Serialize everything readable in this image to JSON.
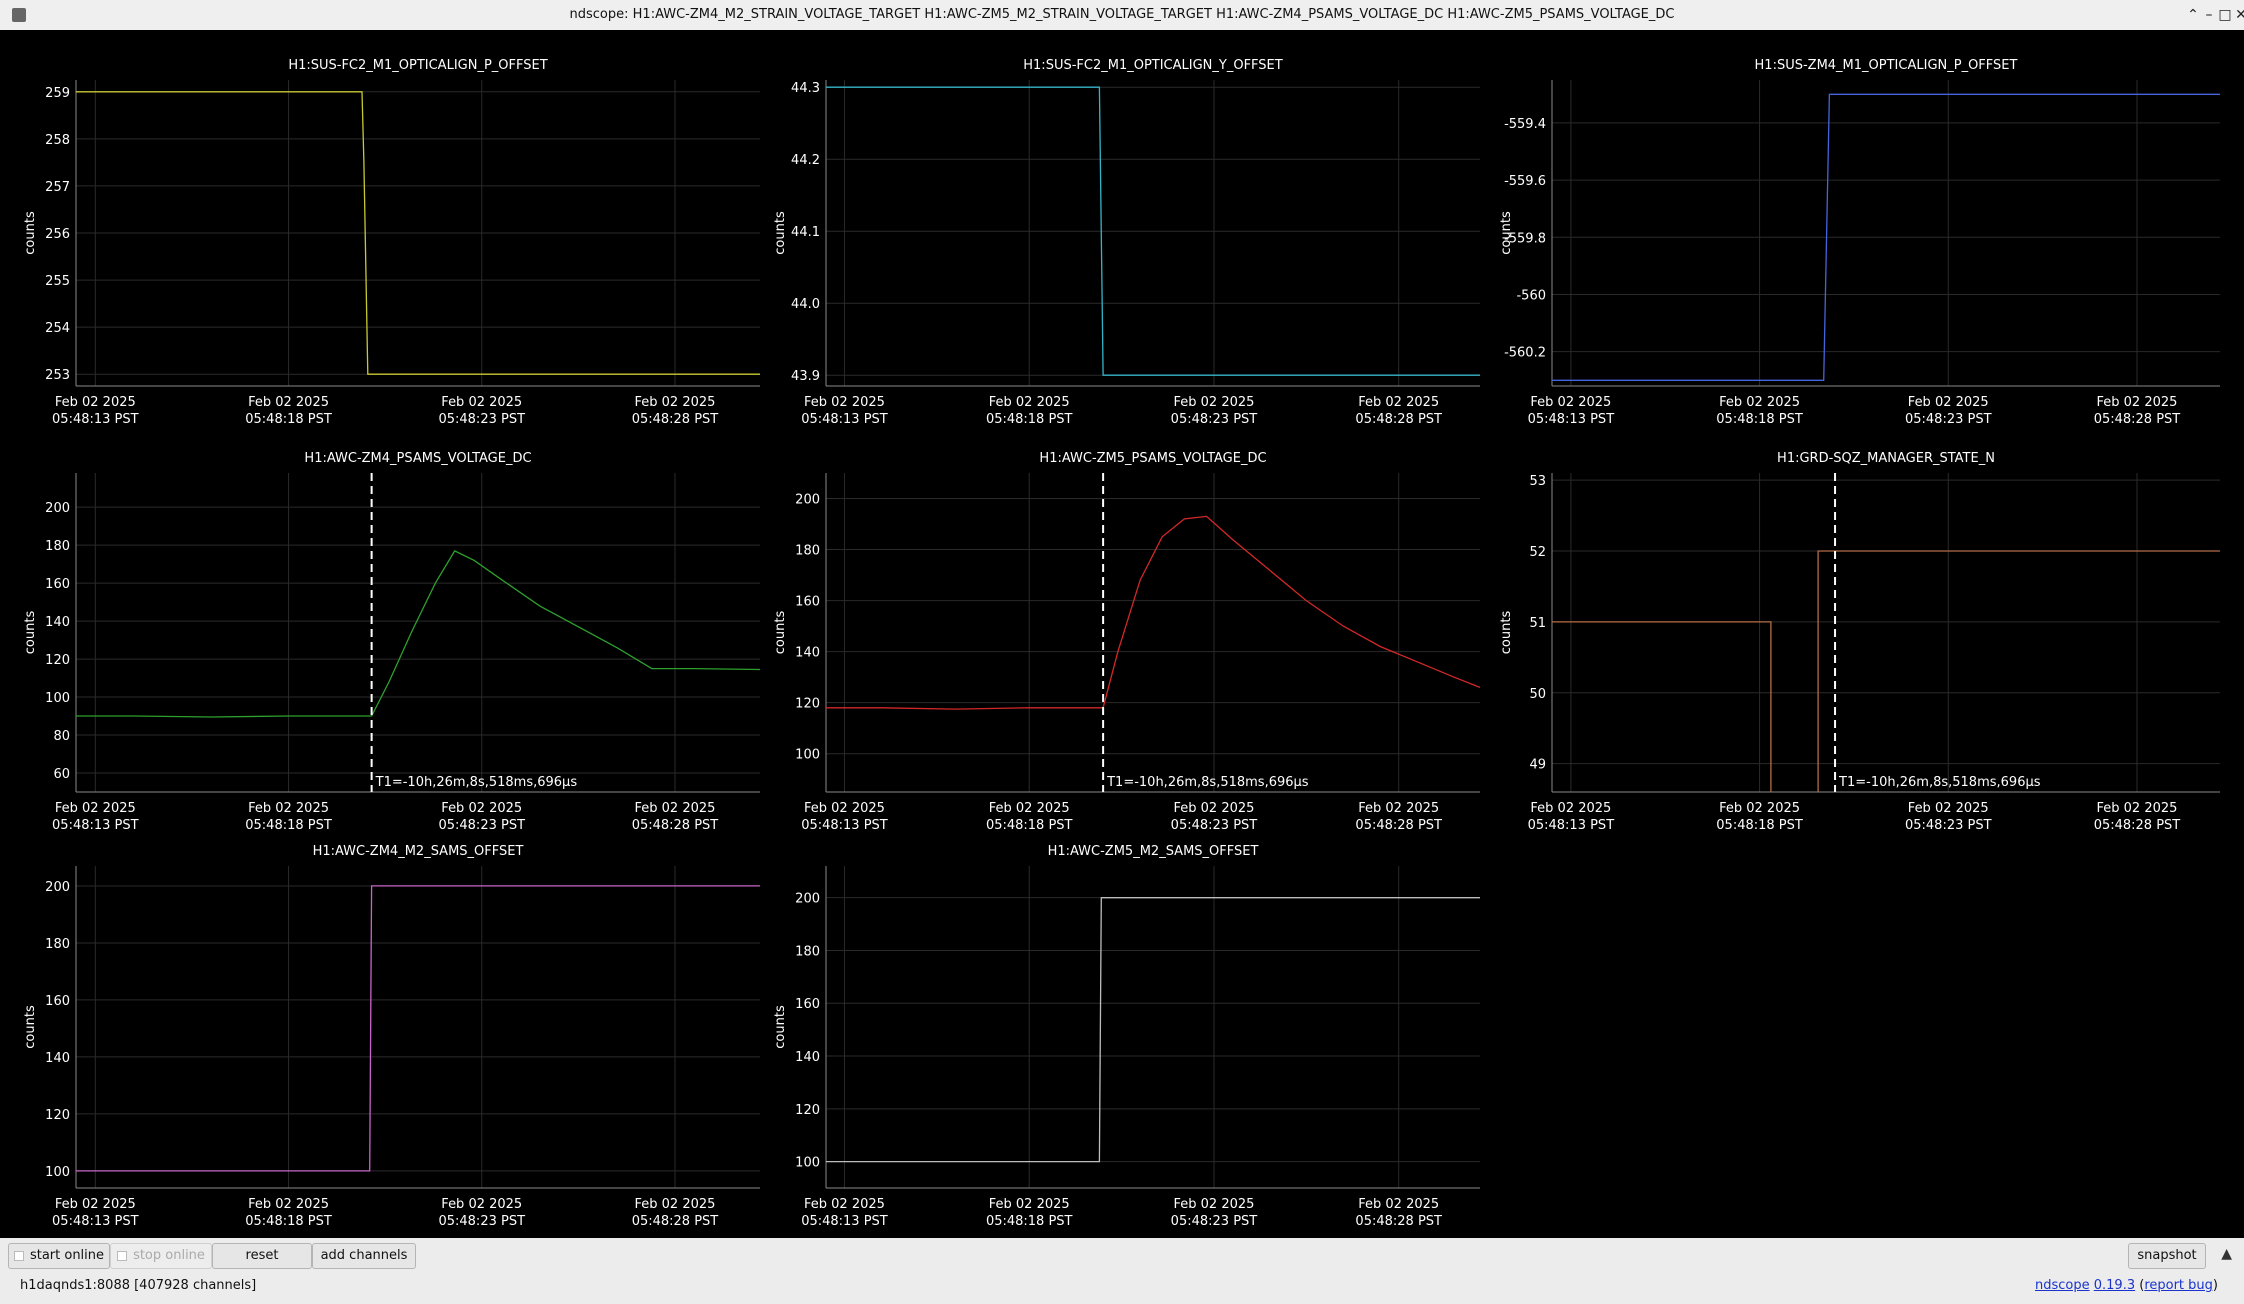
{
  "window": {
    "title": "ndscope: H1:AWC-ZM4_M2_STRAIN_VOLTAGE_TARGET H1:AWC-ZM5_M2_STRAIN_VOLTAGE_TARGET H1:AWC-ZM4_PSAMS_VOLTAGE_DC H1:AWC-ZM5_PSAMS_VOLTAGE_DC",
    "minimize_glyph": "–",
    "maximize_glyph": "□",
    "restore_glyph": "⌃",
    "close_glyph": "✕"
  },
  "toolbar": {
    "start_online": "start online",
    "stop_online": "stop online",
    "reset": "reset",
    "add_channels": "add channels",
    "snapshot": "snapshot",
    "collapse_glyph": "▲"
  },
  "status": {
    "server": "h1daqnds1:8088  [407928 channels]",
    "app_name": "ndscope",
    "version": "0.19.3",
    "report_bug": "report bug"
  },
  "common": {
    "ylabel": "counts",
    "x_ticks": [
      {
        "date": "Feb 02 2025",
        "time": "05:48:13 PST"
      },
      {
        "date": "Feb 02 2025",
        "time": "05:48:18 PST"
      },
      {
        "date": "Feb 02 2025",
        "time": "05:48:23 PST"
      },
      {
        "date": "Feb 02 2025",
        "time": "05:48:28 PST"
      }
    ],
    "cursor_label": "T1=-10h,26m,8s,518ms,696μs"
  },
  "chart_data": [
    {
      "type": "line",
      "title": "H1:SUS-FC2_M1_OPTICALIGN_P_OFFSET",
      "ylabel": "counts",
      "color": "#c8c832",
      "x_range": [
        12.5,
        30.2
      ],
      "ylim": [
        252.75,
        259.25
      ],
      "y_ticks": [
        253,
        254,
        255,
        256,
        257,
        258,
        259
      ],
      "y_tick_labels": [
        "253",
        "254",
        "255",
        "256",
        "257",
        "258",
        "259"
      ],
      "cursor": null,
      "series": [
        {
          "x": [
            12.5,
            19.9,
            19.95,
            20.05,
            30.2
          ],
          "y": [
            259,
            259,
            257.5,
            253,
            253
          ]
        }
      ]
    },
    {
      "type": "line",
      "title": "H1:SUS-FC2_M1_OPTICALIGN_Y_OFFSET",
      "ylabel": "counts",
      "color": "#34b4c8",
      "x_range": [
        12.5,
        30.2
      ],
      "ylim": [
        43.885,
        44.31
      ],
      "y_ticks": [
        43.9,
        44.0,
        44.1,
        44.2,
        44.3
      ],
      "y_tick_labels": [
        "43.9",
        "44.0",
        "44.1",
        "44.2",
        "44.3"
      ],
      "cursor": null,
      "series": [
        {
          "x": [
            12.5,
            19.9,
            20.0,
            30.2
          ],
          "y": [
            44.3,
            44.3,
            43.9,
            43.9
          ]
        }
      ]
    },
    {
      "type": "line",
      "title": "H1:SUS-ZM4_M1_OPTICALIGN_P_OFFSET",
      "ylabel": "counts",
      "color": "#4664dc",
      "x_range": [
        12.5,
        30.2
      ],
      "ylim": [
        -560.32,
        -559.25
      ],
      "y_ticks": [
        -560.2,
        -560,
        -559.8,
        -559.6,
        -559.4
      ],
      "y_tick_labels": [
        "-560.2",
        "-560",
        "-559.8",
        "-559.6",
        "-559.4"
      ],
      "cursor": null,
      "series": [
        {
          "x": [
            12.5,
            19.7,
            19.85,
            30.2
          ],
          "y": [
            -560.3,
            -560.3,
            -559.3,
            -559.3
          ]
        }
      ]
    },
    {
      "type": "line",
      "title": "H1:AWC-ZM4_PSAMS_VOLTAGE_DC",
      "ylabel": "counts",
      "color": "#2ea02e",
      "x_range": [
        12.5,
        30.2
      ],
      "ylim": [
        50,
        218
      ],
      "y_ticks": [
        60,
        80,
        100,
        120,
        140,
        160,
        180,
        200
      ],
      "y_tick_labels": [
        "60",
        "80",
        "100",
        "120",
        "140",
        "160",
        "180",
        "200"
      ],
      "cursor": 20.15,
      "series": [
        {
          "x": [
            12.5,
            14,
            16,
            18,
            20.15,
            20.6,
            21.2,
            21.8,
            22.3,
            22.8,
            23.5,
            24.5,
            25.5,
            26.5,
            27.4,
            28.5,
            30.2
          ],
          "y": [
            90,
            90,
            89.5,
            90,
            90,
            108,
            135,
            160,
            177,
            172,
            162,
            148,
            137,
            126,
            115,
            115,
            114.5
          ]
        }
      ]
    },
    {
      "type": "line",
      "title": "H1:AWC-ZM5_PSAMS_VOLTAGE_DC",
      "ylabel": "counts",
      "color": "#d22828",
      "x_range": [
        12.5,
        30.2
      ],
      "ylim": [
        85,
        210
      ],
      "y_ticks": [
        100,
        120,
        140,
        160,
        180,
        200
      ],
      "y_tick_labels": [
        "100",
        "120",
        "140",
        "160",
        "180",
        "200"
      ],
      "cursor": 20.0,
      "series": [
        {
          "x": [
            12.5,
            14,
            16,
            18,
            20.0,
            20.4,
            21.0,
            21.6,
            22.2,
            22.8,
            23.5,
            24.5,
            25.5,
            26.5,
            27.5,
            28.5,
            29.5,
            30.2
          ],
          "y": [
            118,
            118,
            117.5,
            118,
            118,
            140,
            168,
            185,
            192,
            193,
            184,
            172,
            160,
            150,
            142,
            136,
            130,
            126
          ]
        }
      ]
    },
    {
      "type": "line",
      "title": "H1:GRD-SQZ_MANAGER_STATE_N",
      "ylabel": "counts",
      "color": "#b46e46",
      "x_range": [
        12.5,
        30.2
      ],
      "ylim": [
        48.6,
        53.1
      ],
      "y_ticks": [
        49,
        50,
        51,
        52,
        53
      ],
      "y_tick_labels": [
        "49",
        "50",
        "51",
        "52",
        "53"
      ],
      "cursor": 20.0,
      "series": [
        {
          "x": [
            12.5,
            18.3,
            18.3
          ],
          "y": [
            51,
            51,
            48.6
          ]
        },
        {
          "x": [
            19.55,
            19.55,
            30.2
          ],
          "y": [
            48.6,
            52,
            52
          ]
        }
      ]
    },
    {
      "type": "line",
      "title": "H1:AWC-ZM4_M2_SAMS_OFFSET",
      "ylabel": "counts",
      "color": "#c864c8",
      "x_range": [
        12.5,
        30.2
      ],
      "ylim": [
        94,
        207
      ],
      "y_ticks": [
        100,
        120,
        140,
        160,
        180,
        200
      ],
      "y_tick_labels": [
        "100",
        "120",
        "140",
        "160",
        "180",
        "200"
      ],
      "cursor": null,
      "series": [
        {
          "x": [
            12.5,
            20.1,
            20.15,
            30.2
          ],
          "y": [
            100,
            100,
            200,
            200
          ]
        }
      ]
    },
    {
      "type": "line",
      "title": "H1:AWC-ZM5_M2_SAMS_OFFSET",
      "ylabel": "counts",
      "color": "#bdbdbd",
      "x_range": [
        12.5,
        30.2
      ],
      "ylim": [
        90,
        212
      ],
      "y_ticks": [
        100,
        120,
        140,
        160,
        180,
        200
      ],
      "y_tick_labels": [
        "100",
        "120",
        "140",
        "160",
        "180",
        "200"
      ],
      "cursor": null,
      "series": [
        {
          "x": [
            12.5,
            19.9,
            19.95,
            30.2
          ],
          "y": [
            100,
            100,
            200,
            200
          ]
        }
      ]
    }
  ]
}
